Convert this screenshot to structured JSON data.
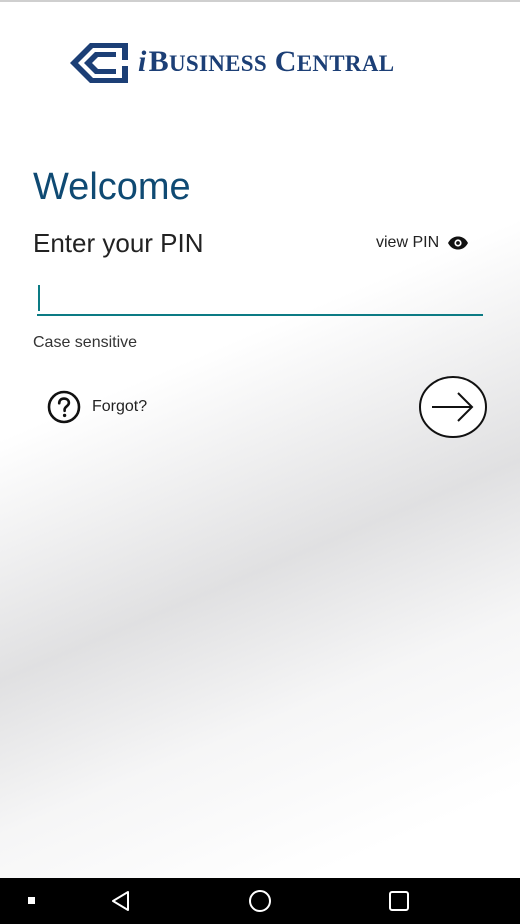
{
  "brand": {
    "name_i": "i",
    "name_b": "B",
    "name_usiness": "USINESS",
    "name_c": "C",
    "name_entral": "ENTRAL",
    "color": "#1c3f76"
  },
  "login": {
    "welcome": "Welcome",
    "pin_label": "Enter your PIN",
    "view_pin_label": "view PIN",
    "view_pin_icon": "eye-icon",
    "pin_value": "",
    "hint": "Case sensitive",
    "forgot_label": "Forgot?",
    "forgot_icon": "question-circle-icon",
    "submit_icon": "arrow-right-circle-icon",
    "accent_color": "#0c7b84",
    "title_color": "#0f4a73"
  },
  "navbar": {
    "items": [
      "square-dot-icon",
      "back-triangle-icon",
      "home-circle-icon",
      "recents-square-icon"
    ]
  }
}
